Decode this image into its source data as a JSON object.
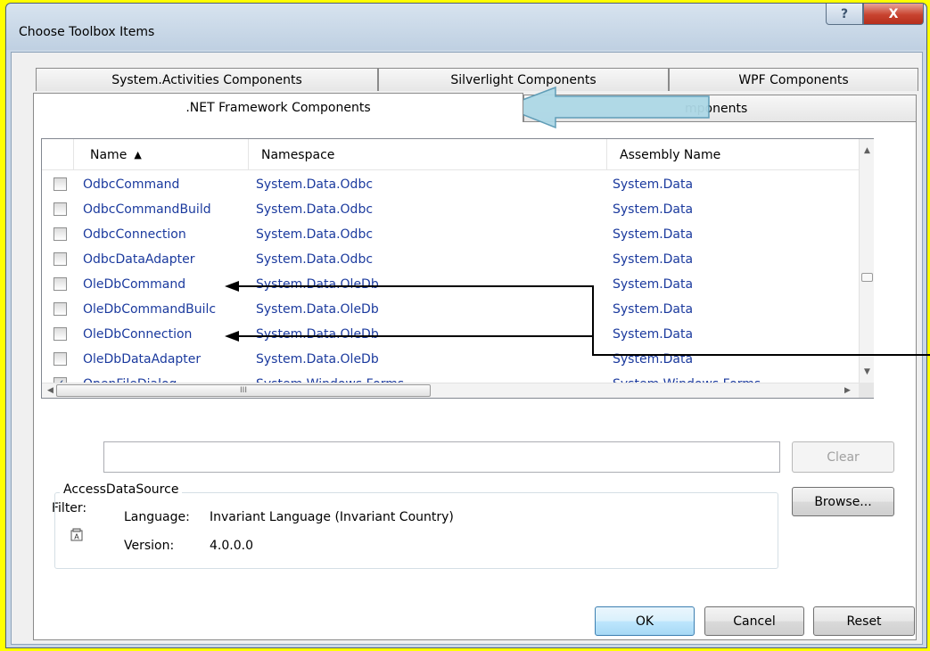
{
  "dialog": {
    "title": "Choose Toolbox Items",
    "help_glyph": "?",
    "close_glyph": "X"
  },
  "tabs": {
    "back_row": [
      "System.Activities Components",
      "Silverlight Components",
      "WPF Components"
    ],
    "front_row_active": ".NET Framework Components",
    "front_row_other": "mponents"
  },
  "grid": {
    "headers": {
      "name": "Name",
      "namespace": "Namespace",
      "assembly": "Assembly Name"
    },
    "sort_indicator": "▲",
    "rows": [
      {
        "name": "OdbcCommand",
        "namespace": "System.Data.Odbc",
        "assembly": "System.Data",
        "checked": false
      },
      {
        "name": "OdbcCommandBuild",
        "namespace": "System.Data.Odbc",
        "assembly": "System.Data",
        "checked": false
      },
      {
        "name": "OdbcConnection",
        "namespace": "System.Data.Odbc",
        "assembly": "System.Data",
        "checked": false
      },
      {
        "name": "OdbcDataAdapter",
        "namespace": "System.Data.Odbc",
        "assembly": "System.Data",
        "checked": false
      },
      {
        "name": "OleDbCommand",
        "namespace": "System.Data.OleDb",
        "assembly": "System.Data",
        "checked": false
      },
      {
        "name": "OleDbCommandBuilc",
        "namespace": "System.Data.OleDb",
        "assembly": "System.Data",
        "checked": false
      },
      {
        "name": "OleDbConnection",
        "namespace": "System.Data.OleDb",
        "assembly": "System.Data",
        "checked": false
      },
      {
        "name": "OleDbDataAdapter",
        "namespace": "System.Data.OleDb",
        "assembly": "System.Data",
        "checked": false
      },
      {
        "name": "OpenFileDialog",
        "namespace": "System.Windows.Forms",
        "assembly": "System.Windows.Forms",
        "checked": true
      }
    ],
    "hscroll_grip": "III"
  },
  "filter": {
    "label": "Filter:",
    "value": "",
    "clear_label": "Clear"
  },
  "info": {
    "group_title": "AccessDataSource",
    "language_label": "Language:",
    "language_value": "Invariant Language (Invariant Country)",
    "version_label": "Version:",
    "version_value": "4.0.0.0"
  },
  "buttons": {
    "browse": "Browse...",
    "ok": "OK",
    "cancel": "Cancel",
    "reset": "Reset"
  },
  "colors": {
    "background": "#ffff00",
    "link_text": "#1b3a9e",
    "annotation_arrow": "#add8e6"
  }
}
